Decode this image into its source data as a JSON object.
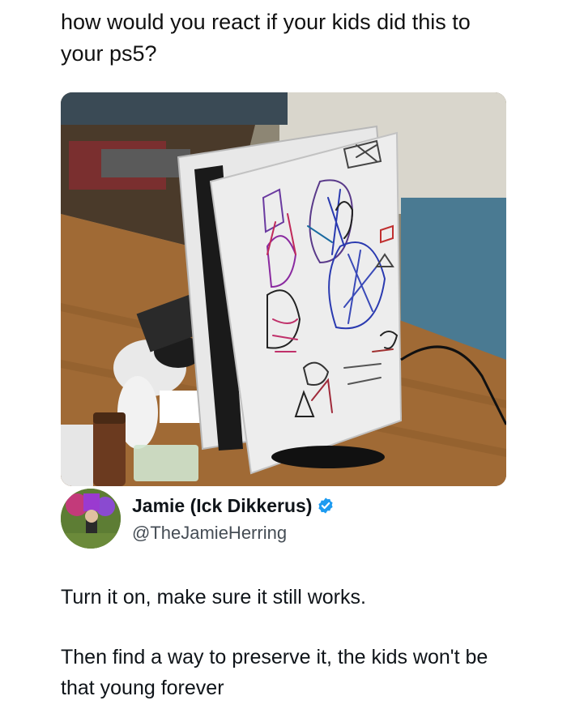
{
  "post": {
    "question": "how would you react if your kids did this to your ps5?"
  },
  "photo": {
    "subject": "PS5 console covered with children's crayon drawings on a wooden desk",
    "icon": "photo-image"
  },
  "reply": {
    "display_name": "Jamie (Ick Dikkerus)",
    "handle": "@TheJamieHerring",
    "verified": true,
    "verified_color": "#1d9bf0",
    "line1": "Turn it on, make sure it still works.",
    "line2": "Then find a way to preserve it, the kids won't be that young forever"
  },
  "colors": {
    "text": "#0f1419",
    "handle": "#454d55",
    "background": "#ffffff"
  }
}
